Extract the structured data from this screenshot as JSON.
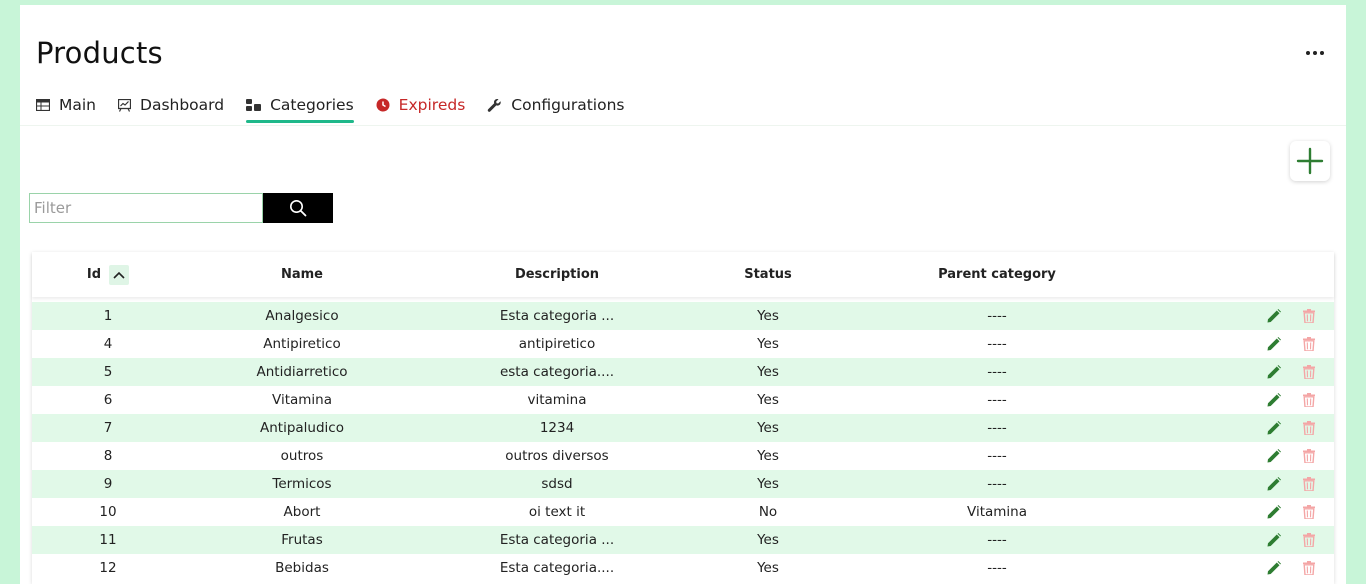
{
  "header": {
    "title": "Products",
    "more_icon": "more-horizontal-icon"
  },
  "tabs": [
    {
      "label": "Main",
      "icon": "table-icon",
      "active": false
    },
    {
      "label": "Dashboard",
      "icon": "chart-board-icon",
      "active": false
    },
    {
      "label": "Categories",
      "icon": "categories-icon",
      "active": true
    },
    {
      "label": "Expireds",
      "icon": "clock-icon",
      "active": false,
      "color": "#c62828"
    },
    {
      "label": "Configurations",
      "icon": "wrench-icon",
      "active": false
    }
  ],
  "toolbar": {
    "add_icon": "plus-icon",
    "filter_placeholder": "Filter",
    "filter_value": "",
    "search_icon": "search-icon"
  },
  "table": {
    "columns": [
      "Id",
      "Name",
      "Description",
      "Status",
      "Parent category"
    ],
    "sort": {
      "column": "Id",
      "direction": "ascending"
    },
    "rows": [
      {
        "id": "1",
        "name": "Analgesico",
        "description": "Esta categoria ...",
        "status": "Yes",
        "parent": "----"
      },
      {
        "id": "4",
        "name": "Antipiretico",
        "description": "antipiretico",
        "status": "Yes",
        "parent": "----"
      },
      {
        "id": "5",
        "name": "Antidiarretico",
        "description": "esta categoria....",
        "status": "Yes",
        "parent": "----"
      },
      {
        "id": "6",
        "name": "Vitamina",
        "description": "vitamina",
        "status": "Yes",
        "parent": "----"
      },
      {
        "id": "7",
        "name": "Antipaludico",
        "description": "1234",
        "status": "Yes",
        "parent": "----"
      },
      {
        "id": "8",
        "name": "outros",
        "description": "outros diversos",
        "status": "Yes",
        "parent": "----"
      },
      {
        "id": "9",
        "name": "Termicos",
        "description": "sdsd",
        "status": "Yes",
        "parent": "----"
      },
      {
        "id": "10",
        "name": "Abort",
        "description": "oi text it",
        "status": "No",
        "parent": "Vitamina"
      },
      {
        "id": "11",
        "name": "Frutas",
        "description": "Esta categoria ...",
        "status": "Yes",
        "parent": "----"
      },
      {
        "id": "12",
        "name": "Bebidas",
        "description": "Esta categoria....",
        "status": "Yes",
        "parent": "----"
      }
    ],
    "row_actions": {
      "edit_icon": "pencil-icon",
      "delete_icon": "trash-icon"
    }
  },
  "colors": {
    "background": "#c8f5d8",
    "accent": "#1fb88a",
    "row_alt": "#e1f9e8",
    "edit": "#2e7d32",
    "delete": "#f4a6a6",
    "expired": "#c62828"
  }
}
